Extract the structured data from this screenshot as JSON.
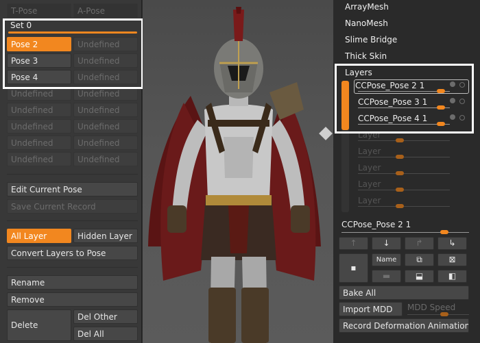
{
  "left": {
    "pose_header": [
      "T-Pose",
      "A-Pose"
    ],
    "set_label": "Set 0",
    "poses": [
      {
        "name": "Pose 2",
        "value": "Undefined"
      },
      {
        "name": "Pose 3",
        "value": "Undefined"
      },
      {
        "name": "Pose 4",
        "value": "Undefined"
      }
    ],
    "undefined_label": "Undefined",
    "edit_current_pose": "Edit Current Pose",
    "save_current_record": "Save Current Record",
    "all_layer": "All Layer",
    "hidden_layer": "Hidden Layer",
    "convert_layers": "Convert Layers to Pose",
    "rename": "Rename",
    "remove": "Remove",
    "delete": "Delete",
    "del_other": "Del Other",
    "del_all": "Del All"
  },
  "right": {
    "menu": [
      "ArrayMesh",
      "NanoMesh",
      "Slime Bridge",
      "Thick Skin"
    ],
    "layers_title": "Layers",
    "layers": [
      {
        "name": "CCPose_Pose 2",
        "value": "1",
        "slider": 0.85
      },
      {
        "name": "CCPose_Pose 3",
        "value": "1",
        "slider": 0.85
      },
      {
        "name": "CCPose_Pose 4",
        "value": "1",
        "slider": 0.85
      }
    ],
    "empty_layer": "Layer",
    "current_layer": {
      "name": "CCPose_Pose 2",
      "value": "1"
    },
    "name_button": "Name",
    "bake_all": "Bake All",
    "import_mdd": "Import MDD",
    "mdd_speed": "MDD Speed",
    "record_deformation": "Record Deformation Animation"
  },
  "colors": {
    "accent": "#f2871f",
    "highlight": "#ffffff"
  }
}
